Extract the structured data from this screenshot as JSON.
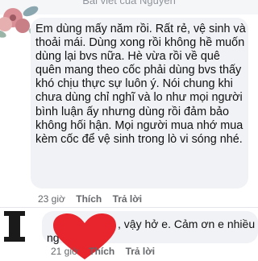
{
  "header": {
    "title": "Bài viết của Nguyễn"
  },
  "comments": [
    {
      "text": "Em dùng mấy năm rồi. Rất rẻ, vệ sinh và thoải mái. Dùng xong rồi không hề muốn dùng lại bvs nữa. Hè vừa rồi về quê quên mang theo cốc phải dùng bvs thấy khó chịu thực sự luôn ý. Nói chung khi chưa dùng chỉ nghĩ và lo như mọi người bình luận ấy nhưng dùng rồi đảm bảo không hối hận. Mọi người mua nhớ mua kèm cốc để vệ sinh trong lò vi sóng nhé.",
      "time": "23 giờ",
      "like": "Thích",
      "reply": "Trả lời"
    },
    {
      "text": ", vậy hở e. Cảm ơn e nhiều",
      "text_line2": "ng",
      "time": "21 giờ",
      "like": "Thích",
      "reply": "Trả lời"
    }
  ],
  "colors": {
    "heart": "#e8242c",
    "bubble": "#f0f2f5",
    "meta": "#65676b"
  }
}
